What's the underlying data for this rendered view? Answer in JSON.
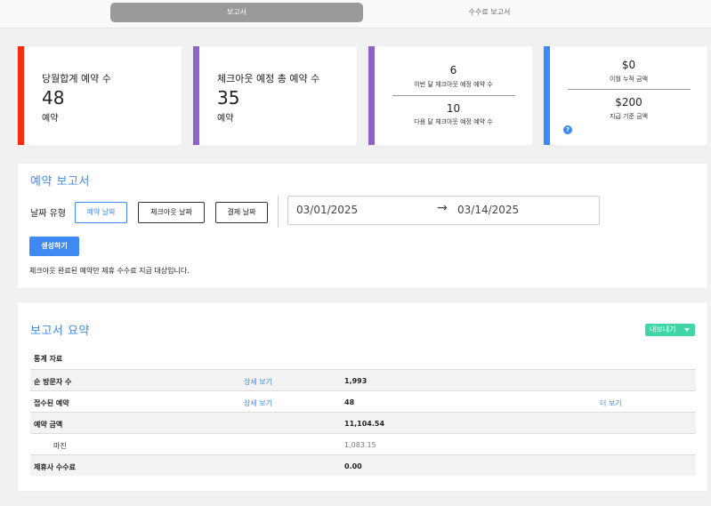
{
  "tabs": [
    {
      "label": "보고서",
      "active": true
    },
    {
      "label": "수수료 보고서",
      "active": false
    }
  ],
  "cards": {
    "monthly_bookings": {
      "label": "당월합계 예약 수",
      "value": "48",
      "unit": "예약",
      "color": "#ff2a0e"
    },
    "checkout_total": {
      "label": "체크아웃 예정 총 예약 수",
      "value": "35",
      "unit": "예약",
      "color": "#8e63c8"
    },
    "checkout_split": {
      "this_month_value": "6",
      "this_month_label": "이번 달 체크아웃 예정 예약 수",
      "next_month_value": "10",
      "next_month_label": "다음 달 체크아웃 예정 예약 수",
      "color": "#8e63c8"
    },
    "payout": {
      "cumulative_value": "$0",
      "cumulative_label": "이월 누적 금액",
      "threshold_value": "$200",
      "threshold_label": "지급 기준 금액",
      "help_icon": "?",
      "color": "#3f8af2"
    }
  },
  "booking_report": {
    "title": "예약 보고서",
    "date_type_label": "날짜 유형",
    "date_type_buttons": [
      "예약 날짜",
      "체크아웃 날짜",
      "결제 날짜"
    ],
    "selected_date_type": "예약 날짜",
    "start_date": "03/01/2025",
    "arrow": "→",
    "end_date": "03/14/2025",
    "generate_label": "생성하기",
    "note": "체크아웃 완료된 예약만 제휴 수수료 지급 대상입니다."
  },
  "summary": {
    "title": "보고서 요약",
    "export_label": "내보내기",
    "table_header": "통계 자료",
    "rows": [
      {
        "label": "순 방문자 수",
        "link": "상세 보기",
        "value": "1,993",
        "more": ""
      },
      {
        "label": "접수된 예약",
        "link": "상세 보기",
        "value": "48",
        "more": "더 보기"
      },
      {
        "label": "예약 금액",
        "link": "",
        "value": "11,104.54",
        "more": ""
      },
      {
        "label": "마진",
        "link": "",
        "value": "1,083.15",
        "more": ""
      },
      {
        "label": "제휴사 수수료",
        "link": "",
        "value": "0.00",
        "more": ""
      }
    ]
  },
  "colors": {
    "accent_blue": "#3f8af2",
    "export_green": "#3ed6a6",
    "red": "#ff2a0e",
    "purple": "#8e63c8"
  }
}
